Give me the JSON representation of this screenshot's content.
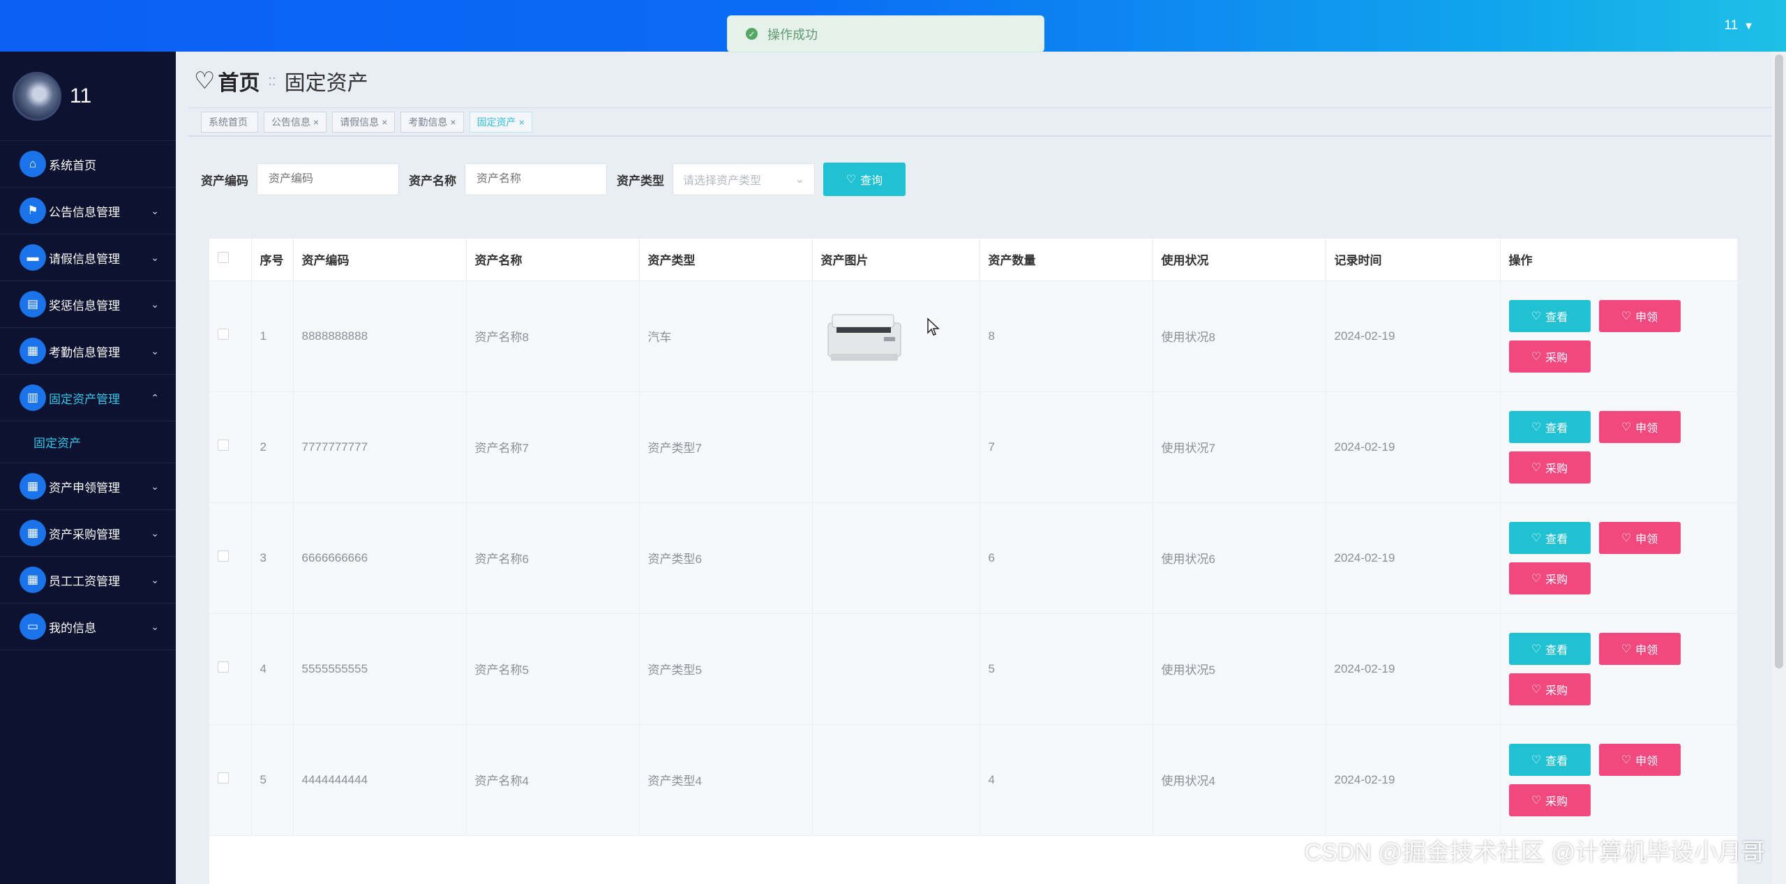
{
  "topbar": {
    "user": "11",
    "caret": "▼"
  },
  "toast": {
    "icon": "check-circle-icon",
    "message": "操作成功"
  },
  "sidebar": {
    "username": "11",
    "items": [
      {
        "label": "系统首页",
        "icon": "home-icon",
        "chev": ""
      },
      {
        "label": "公告信息管理",
        "icon": "flag-icon",
        "chev": "⌄"
      },
      {
        "label": "请假信息管理",
        "icon": "briefcase-icon",
        "chev": "⌄"
      },
      {
        "label": "奖惩信息管理",
        "icon": "document-icon",
        "chev": "⌄"
      },
      {
        "label": "考勤信息管理",
        "icon": "grid-icon",
        "chev": "⌄"
      },
      {
        "label": "固定资产管理",
        "icon": "clipboard-icon",
        "chev": "⌃"
      },
      {
        "label": "资产申领管理",
        "icon": "grid-icon",
        "chev": "⌄"
      },
      {
        "label": "资产采购管理",
        "icon": "grid-icon",
        "chev": "⌄"
      },
      {
        "label": "员工工资管理",
        "icon": "grid-icon",
        "chev": "⌄"
      },
      {
        "label": "我的信息",
        "icon": "card-icon",
        "chev": "⌄"
      }
    ],
    "sub_item": "固定资产"
  },
  "heading": {
    "home": "首页",
    "separator": "::",
    "current": "固定资产"
  },
  "tags": [
    {
      "label": "系统首页",
      "close": ""
    },
    {
      "label": "公告信息",
      "close": "×"
    },
    {
      "label": "请假信息",
      "close": "×"
    },
    {
      "label": "考勤信息",
      "close": "×"
    },
    {
      "label": "固定资产",
      "close": "×"
    }
  ],
  "search": {
    "code_label": "资产编码",
    "code_placeholder": "资产编码",
    "name_label": "资产名称",
    "name_placeholder": "资产名称",
    "type_label": "资产类型",
    "type_placeholder": "请选择资产类型",
    "query_button": "查询"
  },
  "table": {
    "headers": [
      "序号",
      "资产编码",
      "资产名称",
      "资产类型",
      "资产图片",
      "资产数量",
      "使用状况",
      "记录时间",
      "操作"
    ],
    "rows": [
      {
        "no": "1",
        "code": "8888888888",
        "name": "资产名称8",
        "type": "汽车",
        "qty": "8",
        "status": "使用状况8",
        "time": "2024-02-19"
      },
      {
        "no": "2",
        "code": "7777777777",
        "name": "资产名称7",
        "type": "资产类型7",
        "qty": "7",
        "status": "使用状况7",
        "time": "2024-02-19"
      },
      {
        "no": "3",
        "code": "6666666666",
        "name": "资产名称6",
        "type": "资产类型6",
        "qty": "6",
        "status": "使用状况6",
        "time": "2024-02-19"
      },
      {
        "no": "4",
        "code": "5555555555",
        "name": "资产名称5",
        "type": "资产类型5",
        "qty": "5",
        "status": "使用状况5",
        "time": "2024-02-19"
      },
      {
        "no": "5",
        "code": "4444444444",
        "name": "资产名称4",
        "type": "资产类型4",
        "qty": "4",
        "status": "使用状况4",
        "time": "2024-02-19"
      }
    ],
    "btn_view": "查看",
    "btn_apply": "申领",
    "btn_buy": "采购"
  },
  "watermark": "CSDN @掘金技术社区 @计算机毕设小月哥"
}
